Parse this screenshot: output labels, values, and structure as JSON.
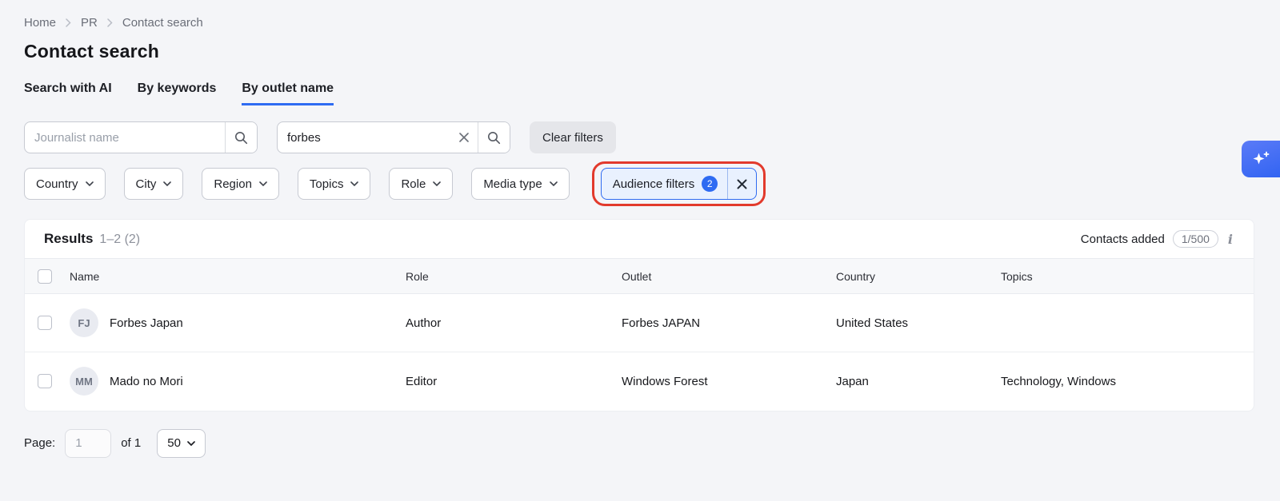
{
  "breadcrumb": {
    "items": [
      "Home",
      "PR",
      "Contact search"
    ]
  },
  "page": {
    "title": "Contact search"
  },
  "tabs": [
    {
      "label": "Search with AI",
      "active": false
    },
    {
      "label": "By keywords",
      "active": false
    },
    {
      "label": "By outlet name",
      "active": true
    }
  ],
  "search": {
    "journalist_placeholder": "Journalist name",
    "outlet_value": "forbes",
    "clear_filters_label": "Clear filters"
  },
  "filters": {
    "dropdowns": [
      "Country",
      "City",
      "Region",
      "Topics",
      "Role",
      "Media type"
    ],
    "audience": {
      "label": "Audience filters",
      "count": "2"
    }
  },
  "results": {
    "title": "Results",
    "range": "1–2 (2)",
    "contacts_added_label": "Contacts added",
    "contacts_added_value": "1/500",
    "columns": [
      "Name",
      "Role",
      "Outlet",
      "Country",
      "Topics"
    ],
    "rows": [
      {
        "initials": "FJ",
        "name": "Forbes Japan",
        "role": "Author",
        "outlet": "Forbes JAPAN",
        "country": "United States",
        "topics": ""
      },
      {
        "initials": "MM",
        "name": "Mado no Mori",
        "role": "Editor",
        "outlet": "Windows Forest",
        "country": "Japan",
        "topics": "Technology, Windows"
      }
    ]
  },
  "pagination": {
    "label": "Page:",
    "page_value": "1",
    "of_text": "of 1",
    "page_size": "50"
  },
  "icons": {
    "info": "i"
  },
  "colors": {
    "accent": "#2e6bf2",
    "annotation_red": "#e23a2c",
    "badge_blue": "#2e6bf2",
    "chip_bg": "#e9f1fe"
  }
}
